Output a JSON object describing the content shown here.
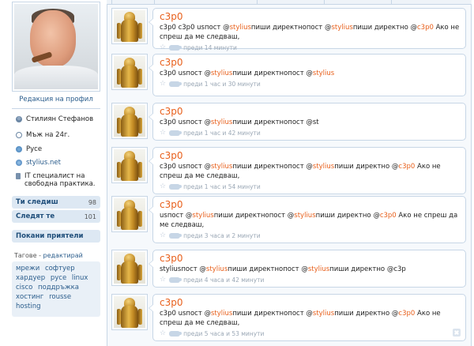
{
  "profile": {
    "edit_label": "Редакция на профил",
    "name": "Стилиян Стефанов",
    "age": "Мъж на 24г.",
    "location": "Русе",
    "website": "stylius.net",
    "bio": "IT специалист на свободна практика."
  },
  "stats": {
    "following_label": "Ти следиш",
    "following_count": "98",
    "followers_label": "Следят те",
    "followers_count": "101",
    "invite_label": "Покани приятели"
  },
  "tags": {
    "title": "Тагове",
    "edit": "редактирай",
    "items": [
      "мрежи",
      "софтуер",
      "хардуер",
      "русе",
      "linux",
      "cisco",
      "поддръжка",
      "хостинг",
      "rousse",
      "hosting"
    ]
  },
  "tweets": [
    {
      "author": "c3p0",
      "parts": [
        [
          "c3p0 c3p0 usпост ",
          ""
        ],
        [
          "@",
          ""
        ],
        [
          "stylius",
          "m"
        ],
        [
          "пиши директнопост ",
          ""
        ],
        [
          "@",
          ""
        ],
        [
          "stylius",
          "m"
        ],
        [
          "пиши директно ",
          ""
        ],
        [
          "@",
          ""
        ],
        [
          "c3p0",
          "m"
        ],
        [
          " Ако не спреш да ме следваш,",
          ""
        ]
      ],
      "time": "преди 14 минути",
      "has_delete": false
    },
    {
      "author": "c3p0",
      "parts": [
        [
          "c3p0 usпост ",
          ""
        ],
        [
          "@",
          ""
        ],
        [
          "stylius",
          "m"
        ],
        [
          "пиши директнопост ",
          ""
        ],
        [
          "@",
          ""
        ],
        [
          "stylius",
          "m"
        ]
      ],
      "time": "преди 1 час и 30 минути",
      "has_delete": false
    },
    {
      "author": "c3p0",
      "parts": [
        [
          "c3p0 usпост ",
          ""
        ],
        [
          "@",
          ""
        ],
        [
          "stylius",
          "m"
        ],
        [
          "пиши директнопост @st",
          ""
        ]
      ],
      "time": "преди 1 час и 42 минути",
      "has_delete": false
    },
    {
      "author": "c3p0",
      "parts": [
        [
          "c3p0 usпост ",
          ""
        ],
        [
          "@",
          ""
        ],
        [
          "stylius",
          "m"
        ],
        [
          "пиши директнопост ",
          ""
        ],
        [
          "@",
          ""
        ],
        [
          "stylius",
          "m"
        ],
        [
          "пиши директно ",
          ""
        ],
        [
          "@",
          ""
        ],
        [
          "c3p0",
          "m"
        ],
        [
          " Ако не спреш да ме следваш,",
          ""
        ]
      ],
      "time": "преди 1 час и 54 минути",
      "has_delete": false
    },
    {
      "author": "c3p0",
      "parts": [
        [
          "usпост ",
          ""
        ],
        [
          "@",
          ""
        ],
        [
          "stylius",
          "m"
        ],
        [
          "пиши директнопост ",
          ""
        ],
        [
          "@",
          ""
        ],
        [
          "stylius",
          "m"
        ],
        [
          "пиши директно ",
          ""
        ],
        [
          "@",
          ""
        ],
        [
          "c3p0",
          "m"
        ],
        [
          " Ако не спреш да ме следваш,",
          ""
        ]
      ],
      "time": "преди 3 часа и 2 минути",
      "has_delete": false
    },
    {
      "author": "c3p0",
      "parts": [
        [
          "styliusпост ",
          ""
        ],
        [
          "@",
          ""
        ],
        [
          "stylius",
          "m"
        ],
        [
          "пиши директнопост ",
          ""
        ],
        [
          "@",
          ""
        ],
        [
          "stylius",
          "m"
        ],
        [
          "пиши директно @c3p",
          ""
        ]
      ],
      "time": "преди 4 часа и 42 минути",
      "has_delete": false
    },
    {
      "author": "c3p0",
      "parts": [
        [
          "c3p0 usпост ",
          ""
        ],
        [
          "@",
          ""
        ],
        [
          "stylius",
          "m"
        ],
        [
          "пиши директнопост ",
          ""
        ],
        [
          "@",
          ""
        ],
        [
          "stylius",
          "m"
        ],
        [
          "пиши директно ",
          ""
        ],
        [
          "@",
          ""
        ],
        [
          "c3p0",
          "m"
        ],
        [
          " Ако не спреш да ме следваш,",
          ""
        ]
      ],
      "time": "преди 5 часа и 53 минути",
      "has_delete": true
    }
  ]
}
